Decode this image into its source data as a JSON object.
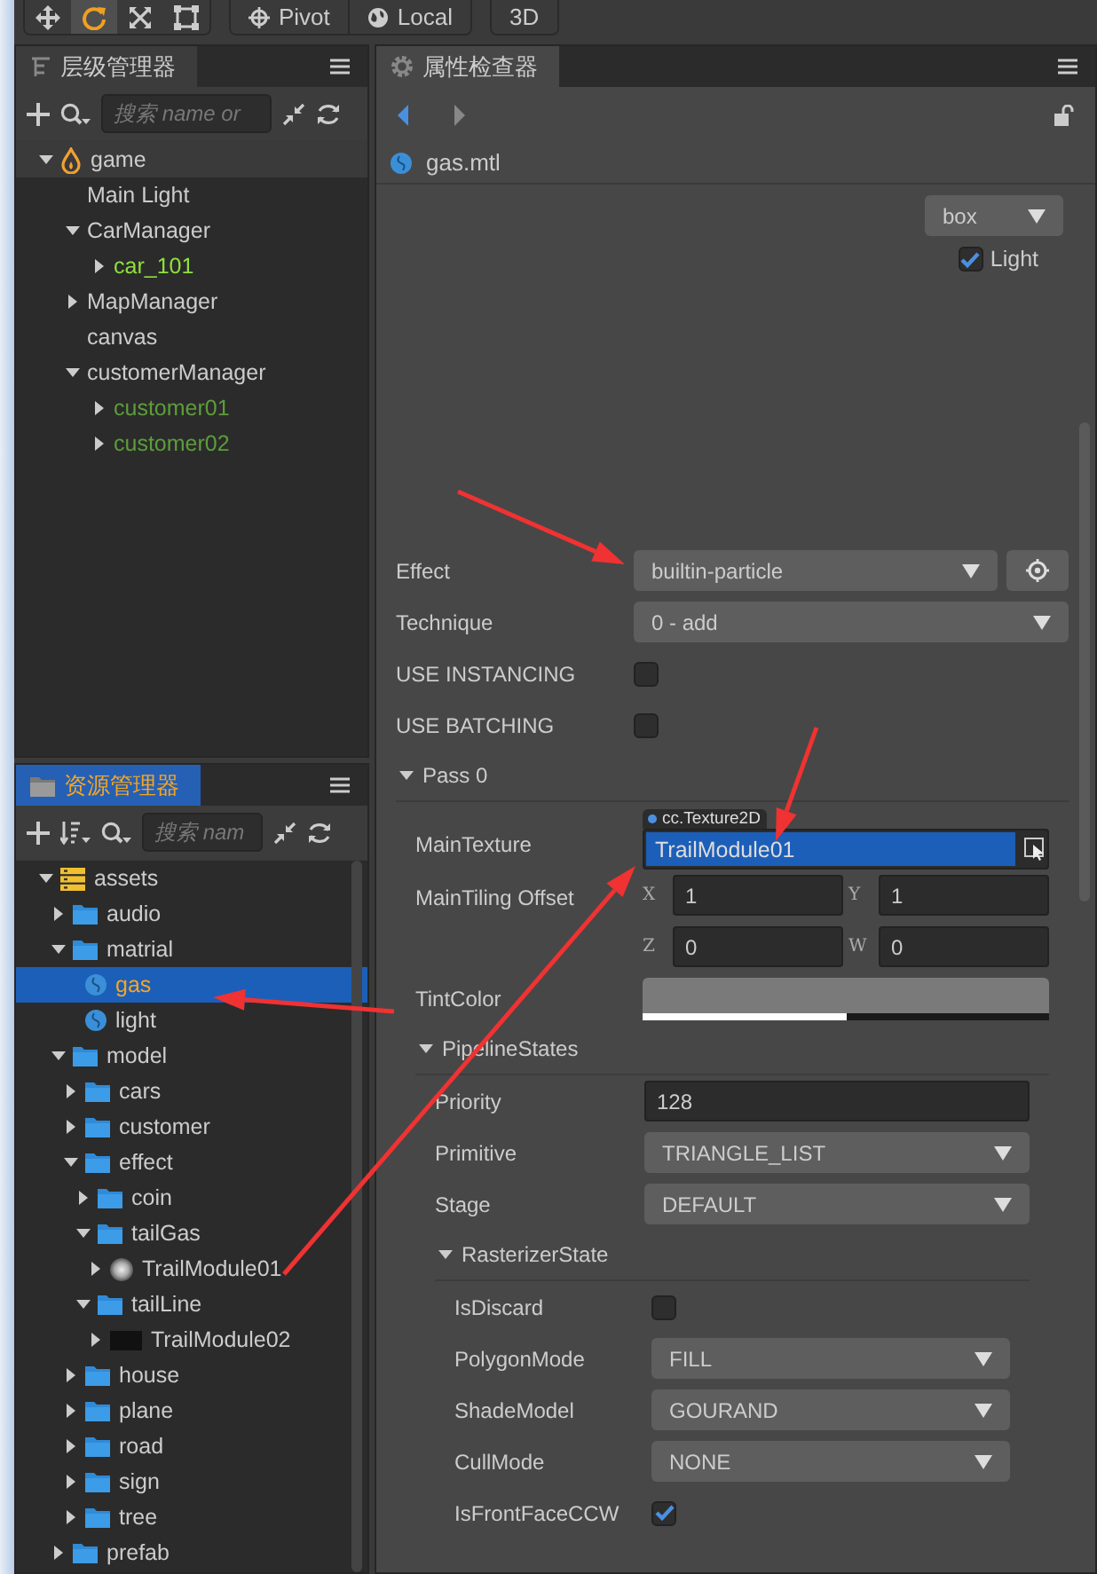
{
  "toolbar": {
    "tools": [
      {
        "kind": "move",
        "selected": false
      },
      {
        "kind": "rotate",
        "selected": true
      },
      {
        "kind": "scale",
        "selected": false
      },
      {
        "kind": "rect",
        "selected": false
      }
    ],
    "pivot": "Pivot",
    "space": "Local",
    "mode": "3D"
  },
  "hierarchy": {
    "title": "层级管理器",
    "focused": false,
    "search_placeholder": "搜索 name or",
    "tree": [
      {
        "label": "game",
        "kind": "scene",
        "color": "#cccccc",
        "expanded": true,
        "children": [
          {
            "label": "Main Light",
            "kind": "node",
            "color": "#cccccc"
          },
          {
            "label": "CarManager",
            "kind": "node",
            "color": "#cccccc",
            "expanded": true,
            "children": [
              {
                "label": "car_101",
                "kind": "node",
                "color": "#8fe03c",
                "expanded": false
              }
            ]
          },
          {
            "label": "MapManager",
            "kind": "node",
            "color": "#cccccc",
            "expanded": false
          },
          {
            "label": "canvas",
            "kind": "node",
            "color": "#cccccc"
          },
          {
            "label": "customerManager",
            "kind": "node",
            "color": "#cccccc",
            "expanded": true,
            "children": [
              {
                "label": "customer01",
                "kind": "node",
                "color": "#5c9e3a",
                "expanded": false
              },
              {
                "label": "customer02",
                "kind": "node",
                "color": "#5c9e3a",
                "expanded": false
              }
            ]
          }
        ]
      }
    ]
  },
  "assets": {
    "title": "资源管理器",
    "focused": true,
    "search_placeholder": "搜索 nam",
    "tree": [
      {
        "label": "assets",
        "kind": "db",
        "selected": false,
        "expanded": true,
        "children": [
          {
            "label": "audio",
            "kind": "folder",
            "selected": false,
            "expanded": false
          },
          {
            "label": "matrial",
            "kind": "folder",
            "selected": false,
            "expanded": true,
            "children": [
              {
                "label": "gas",
                "kind": "material",
                "selected": true
              },
              {
                "label": "light",
                "kind": "material",
                "selected": false
              }
            ]
          },
          {
            "label": "model",
            "kind": "folder",
            "selected": false,
            "expanded": true,
            "children": [
              {
                "label": "cars",
                "kind": "folder",
                "selected": false,
                "expanded": false
              },
              {
                "label": "customer",
                "kind": "folder",
                "selected": false,
                "expanded": false
              },
              {
                "label": "effect",
                "kind": "folder",
                "selected": false,
                "expanded": true,
                "children": [
                  {
                    "label": "coin",
                    "kind": "folder",
                    "selected": false,
                    "expanded": false
                  },
                  {
                    "label": "tailGas",
                    "kind": "folder",
                    "selected": false,
                    "expanded": true,
                    "children": [
                      {
                        "label": "TrailModule01",
                        "kind": "puff",
                        "selected": false,
                        "expanded": false
                      }
                    ]
                  },
                  {
                    "label": "tailLine",
                    "kind": "folder",
                    "selected": false,
                    "expanded": true,
                    "children": [
                      {
                        "label": "TrailModule02",
                        "kind": "texture",
                        "selected": false,
                        "expanded": false
                      }
                    ]
                  }
                ]
              },
              {
                "label": "house",
                "kind": "folder",
                "selected": false,
                "expanded": false
              },
              {
                "label": "plane",
                "kind": "folder",
                "selected": false,
                "expanded": false
              },
              {
                "label": "road",
                "kind": "folder",
                "selected": false,
                "expanded": false
              },
              {
                "label": "sign",
                "kind": "folder",
                "selected": false,
                "expanded": false
              },
              {
                "label": "tree",
                "kind": "folder",
                "selected": false,
                "expanded": false
              }
            ]
          },
          {
            "label": "prefab",
            "kind": "folder",
            "selected": false,
            "expanded": false
          }
        ]
      }
    ]
  },
  "inspector": {
    "title": "属性检查器",
    "focused": false,
    "file": "gas.mtl",
    "preview": {
      "mesh": "box",
      "light_label": "Light",
      "light_checked": true
    },
    "properties": [
      {
        "kind": "select",
        "label": "Effect",
        "value": "builtin-particle",
        "locate": true
      },
      {
        "kind": "select",
        "label": "Technique",
        "value": "0 - add"
      },
      {
        "kind": "checkbox",
        "label": "USE INSTANCING",
        "checked": false
      },
      {
        "kind": "checkbox",
        "label": "USE BATCHING",
        "checked": false
      },
      {
        "kind": "section",
        "label": "Pass 0",
        "expanded": true,
        "children": [
          {
            "kind": "asset",
            "label": "MainTexture",
            "type": "cc.Texture2D",
            "value": "TrailModule01"
          },
          {
            "kind": "vec4",
            "label": "MainTiling Offset",
            "components": [
              {
                "axis": "X",
                "value": "1"
              },
              {
                "axis": "Y",
                "value": "1"
              },
              {
                "axis": "Z",
                "value": "0"
              },
              {
                "axis": "W",
                "value": "0"
              }
            ]
          },
          {
            "kind": "color",
            "label": "TintColor",
            "color": "#7a7a7a",
            "level": 0.5
          },
          {
            "kind": "section",
            "label": "PipelineStates",
            "expanded": true,
            "children": [
              {
                "kind": "number",
                "label": "Priority",
                "value": "128"
              },
              {
                "kind": "select",
                "label": "Primitive",
                "value": "TRIANGLE_LIST"
              },
              {
                "kind": "select",
                "label": "Stage",
                "value": "DEFAULT"
              },
              {
                "kind": "section",
                "label": "RasterizerState",
                "expanded": true,
                "children": [
                  {
                    "kind": "checkbox",
                    "label": "IsDiscard",
                    "checked": false
                  },
                  {
                    "kind": "select",
                    "label": "PolygonMode",
                    "value": "FILL"
                  },
                  {
                    "kind": "select",
                    "label": "ShadeModel",
                    "value": "GOURAND"
                  },
                  {
                    "kind": "select",
                    "label": "CullMode",
                    "value": "NONE"
                  },
                  {
                    "kind": "checkbox",
                    "label": "IsFrontFaceCCW",
                    "checked": true
                  }
                ]
              }
            ]
          }
        ]
      }
    ]
  }
}
